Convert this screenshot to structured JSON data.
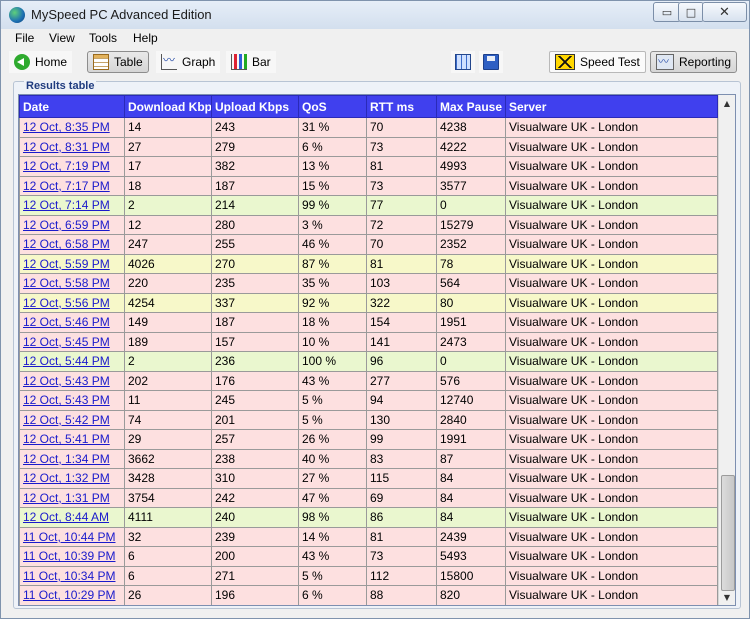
{
  "window": {
    "title": "MySpeed PC Advanced Edition",
    "controls": {
      "minimize": "▭",
      "maximize": "□",
      "close": "✕"
    }
  },
  "menu": [
    "File",
    "View",
    "Tools",
    "Help"
  ],
  "toolbar": {
    "home": "Home",
    "table": "Table",
    "graph": "Graph",
    "bar": "Bar",
    "speed_test": "Speed Test",
    "reporting": "Reporting",
    "icons": [
      "home-icon",
      "table-icon",
      "graph-icon",
      "bar-chart-icon",
      "columns-icon",
      "save-icon",
      "speed-test-icon",
      "reporting-icon"
    ]
  },
  "results": {
    "label": "Results table",
    "columns": [
      "Date",
      "Download Kbps",
      "Upload Kbps",
      "QoS",
      "RTT ms",
      "Max Pause",
      "Server"
    ],
    "row_colors": {
      "pink": "#fde0e0",
      "green": "#eaf7cf",
      "yellow": "#f7f8c9"
    },
    "header_color": "#4040ee",
    "rows": [
      {
        "date": "12 Oct, 8:35 PM",
        "download": "14",
        "upload": "243",
        "qos": "31 %",
        "rtt": "70",
        "pause": "4238",
        "server": "Visualware UK - London",
        "status": "pink"
      },
      {
        "date": "12 Oct, 8:31 PM",
        "download": "27",
        "upload": "279",
        "qos": "6 %",
        "rtt": "73",
        "pause": "4222",
        "server": "Visualware UK - London",
        "status": "pink"
      },
      {
        "date": "12 Oct, 7:19 PM",
        "download": "17",
        "upload": "382",
        "qos": "13 %",
        "rtt": "81",
        "pause": "4993",
        "server": "Visualware UK - London",
        "status": "pink"
      },
      {
        "date": "12 Oct, 7:17 PM",
        "download": "18",
        "upload": "187",
        "qos": "15 %",
        "rtt": "73",
        "pause": "3577",
        "server": "Visualware UK - London",
        "status": "pink"
      },
      {
        "date": "12 Oct, 7:14 PM",
        "download": "2",
        "upload": "214",
        "qos": "99 %",
        "rtt": "77",
        "pause": "0",
        "server": "Visualware UK - London",
        "status": "green"
      },
      {
        "date": "12 Oct, 6:59 PM",
        "download": "12",
        "upload": "280",
        "qos": "3 %",
        "rtt": "72",
        "pause": "15279",
        "server": "Visualware UK - London",
        "status": "pink"
      },
      {
        "date": "12 Oct, 6:58 PM",
        "download": "247",
        "upload": "255",
        "qos": "46 %",
        "rtt": "70",
        "pause": "2352",
        "server": "Visualware UK - London",
        "status": "pink"
      },
      {
        "date": "12 Oct, 5:59 PM",
        "download": "4026",
        "upload": "270",
        "qos": "87 %",
        "rtt": "81",
        "pause": "78",
        "server": "Visualware UK - London",
        "status": "yellow"
      },
      {
        "date": "12 Oct, 5:58 PM",
        "download": "220",
        "upload": "235",
        "qos": "35 %",
        "rtt": "103",
        "pause": "564",
        "server": "Visualware UK - London",
        "status": "pink"
      },
      {
        "date": "12 Oct, 5:56 PM",
        "download": "4254",
        "upload": "337",
        "qos": "92 %",
        "rtt": "322",
        "pause": "80",
        "server": "Visualware UK - London",
        "status": "yellow"
      },
      {
        "date": "12 Oct, 5:46 PM",
        "download": "149",
        "upload": "187",
        "qos": "18 %",
        "rtt": "154",
        "pause": "1951",
        "server": "Visualware UK - London",
        "status": "pink"
      },
      {
        "date": "12 Oct, 5:45 PM",
        "download": "189",
        "upload": "157",
        "qos": "10 %",
        "rtt": "141",
        "pause": "2473",
        "server": "Visualware UK - London",
        "status": "pink"
      },
      {
        "date": "12 Oct, 5:44 PM",
        "download": "2",
        "upload": "236",
        "qos": "100 %",
        "rtt": "96",
        "pause": "0",
        "server": "Visualware UK - London",
        "status": "green"
      },
      {
        "date": "12 Oct, 5:43 PM",
        "download": "202",
        "upload": "176",
        "qos": "43 %",
        "rtt": "277",
        "pause": "576",
        "server": "Visualware UK - London",
        "status": "pink"
      },
      {
        "date": "12 Oct, 5:43 PM",
        "download": "11",
        "upload": "245",
        "qos": "5 %",
        "rtt": "94",
        "pause": "12740",
        "server": "Visualware UK - London",
        "status": "pink"
      },
      {
        "date": "12 Oct, 5:42 PM",
        "download": "74",
        "upload": "201",
        "qos": "5 %",
        "rtt": "130",
        "pause": "2840",
        "server": "Visualware UK - London",
        "status": "pink"
      },
      {
        "date": "12 Oct, 5:41 PM",
        "download": "29",
        "upload": "257",
        "qos": "26 %",
        "rtt": "99",
        "pause": "1991",
        "server": "Visualware UK - London",
        "status": "pink"
      },
      {
        "date": "12 Oct, 1:34 PM",
        "download": "3662",
        "upload": "238",
        "qos": "40 %",
        "rtt": "83",
        "pause": "87",
        "server": "Visualware UK - London",
        "status": "pink"
      },
      {
        "date": "12 Oct, 1:32 PM",
        "download": "3428",
        "upload": "310",
        "qos": "27 %",
        "rtt": "115",
        "pause": "84",
        "server": "Visualware UK - London",
        "status": "pink"
      },
      {
        "date": "12 Oct, 1:31 PM",
        "download": "3754",
        "upload": "242",
        "qos": "47 %",
        "rtt": "69",
        "pause": "84",
        "server": "Visualware UK - London",
        "status": "pink"
      },
      {
        "date": "12 Oct, 8:44 AM",
        "download": "4111",
        "upload": "240",
        "qos": "98 %",
        "rtt": "86",
        "pause": "84",
        "server": "Visualware UK - London",
        "status": "green"
      },
      {
        "date": "11 Oct, 10:44 PM",
        "download": "32",
        "upload": "239",
        "qos": "14 %",
        "rtt": "81",
        "pause": "2439",
        "server": "Visualware UK - London",
        "status": "pink"
      },
      {
        "date": "11 Oct, 10:39 PM",
        "download": "6",
        "upload": "200",
        "qos": "43 %",
        "rtt": "73",
        "pause": "5493",
        "server": "Visualware UK - London",
        "status": "pink"
      },
      {
        "date": "11 Oct, 10:34 PM",
        "download": "6",
        "upload": "271",
        "qos": "5 %",
        "rtt": "112",
        "pause": "15800",
        "server": "Visualware UK - London",
        "status": "pink"
      },
      {
        "date": "11 Oct, 10:29 PM",
        "download": "26",
        "upload": "196",
        "qos": "6 %",
        "rtt": "88",
        "pause": "820",
        "server": "Visualware UK - London",
        "status": "pink"
      }
    ]
  }
}
